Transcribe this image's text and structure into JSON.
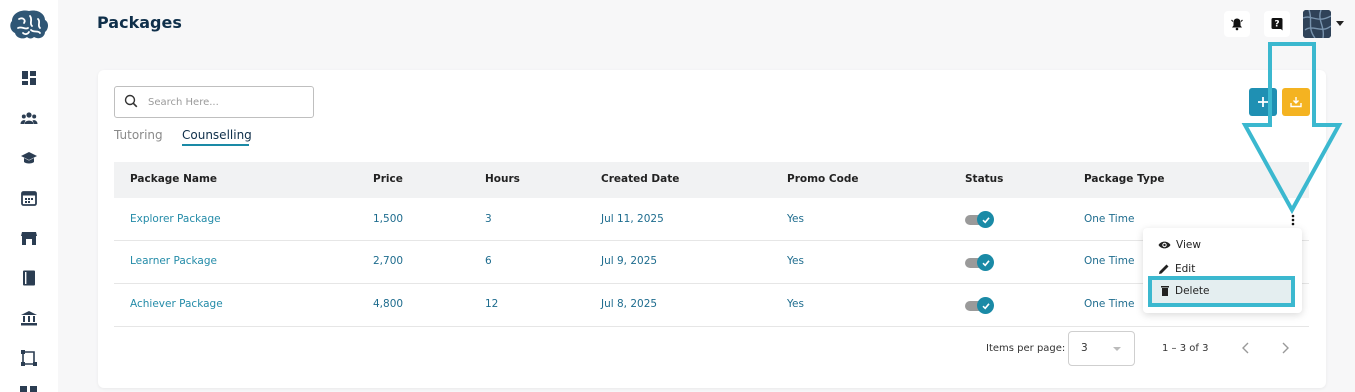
{
  "page": {
    "title": "Packages"
  },
  "sidebar": {
    "items": [
      {
        "icon": "dashboard-icon"
      },
      {
        "icon": "users-icon"
      },
      {
        "icon": "graduation-cap-icon"
      },
      {
        "icon": "calendar-icon"
      },
      {
        "icon": "store-icon"
      },
      {
        "icon": "book-icon"
      },
      {
        "icon": "bank-icon"
      },
      {
        "icon": "workflow-icon"
      }
    ]
  },
  "header": {
    "notification_icon": "bell-icon",
    "help_icon": "help-icon"
  },
  "search": {
    "placeholder": "Search Here..."
  },
  "tabs": [
    {
      "label": "Tutoring",
      "active": false
    },
    {
      "label": "Counselling",
      "active": true
    }
  ],
  "table": {
    "columns": [
      "Package Name",
      "Price",
      "Hours",
      "Created Date",
      "Promo Code",
      "Status",
      "Package Type"
    ],
    "rows": [
      {
        "name": "Explorer Package",
        "price": "1,500",
        "hours": "3",
        "created": "Jul 11, 2025",
        "promo": "Yes",
        "status": true,
        "type": "One Time"
      },
      {
        "name": "Learner Package",
        "price": "2,700",
        "hours": "6",
        "created": "Jul 9, 2025",
        "promo": "Yes",
        "status": true,
        "type": "One Time"
      },
      {
        "name": "Achiever Package",
        "price": "4,800",
        "hours": "12",
        "created": "Jul 8, 2025",
        "promo": "Yes",
        "status": true,
        "type": "One Time"
      }
    ]
  },
  "row_menu": {
    "items": [
      {
        "label": "View",
        "icon": "eye-icon"
      },
      {
        "label": "Edit",
        "icon": "pencil-icon"
      },
      {
        "label": "Delete",
        "icon": "trash-icon"
      }
    ]
  },
  "paginator": {
    "items_per_page_label": "Items per page:",
    "items_per_page_value": "3",
    "range": "1 – 3 of 3"
  },
  "colors": {
    "accent": "#1a8aa6",
    "add_button": "#1f90b3",
    "download_button": "#f4b321",
    "highlight": "#3bb8cf"
  }
}
